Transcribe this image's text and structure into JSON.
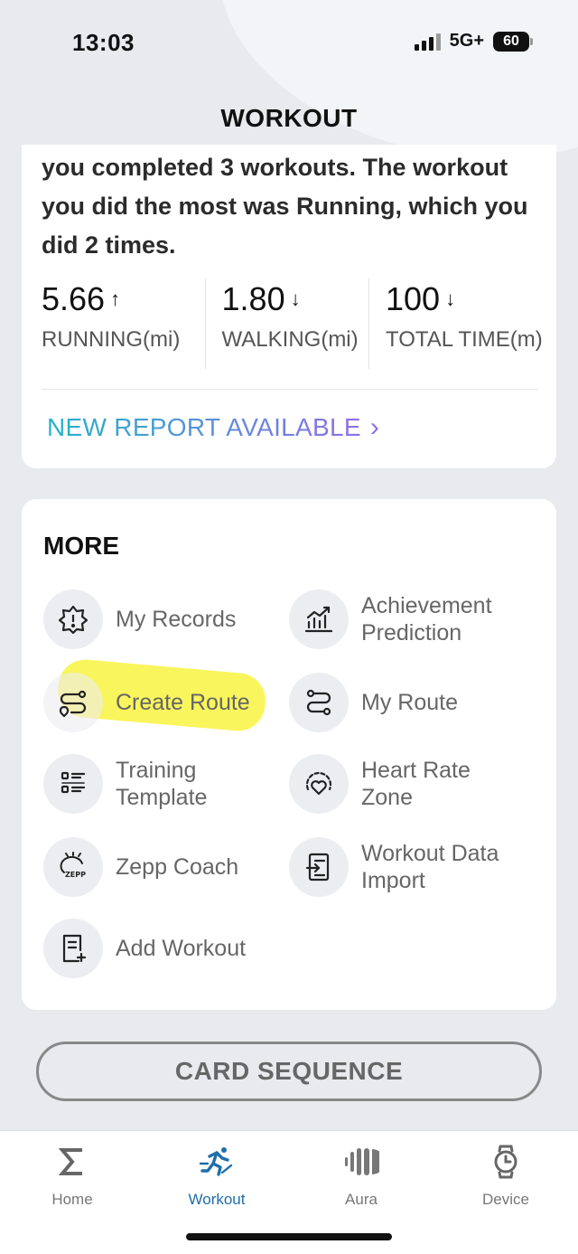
{
  "status_bar": {
    "time": "13:03",
    "network": "5G+",
    "battery": "60"
  },
  "header": {
    "title": "WORKOUT"
  },
  "report": {
    "text": "you completed 3 workouts. The workout you did the most was Running, which you did 2 times.",
    "stats": [
      {
        "value": "5.66",
        "trend": "↑",
        "label": "RUNNING(mi)"
      },
      {
        "value": "1.80",
        "trend": "↓",
        "label": "WALKING(mi)"
      },
      {
        "value": "100",
        "trend": "↓",
        "label": "TOTAL TIME(m)"
      }
    ],
    "new_report_label": "NEW REPORT AVAILABLE"
  },
  "more": {
    "title": "MORE",
    "items": [
      {
        "label": "My Records",
        "icon": "records-badge-icon"
      },
      {
        "label": "Achievement Prediction",
        "icon": "trend-chart-icon"
      },
      {
        "label": "Create Route",
        "icon": "create-route-icon"
      },
      {
        "label": "My Route",
        "icon": "route-icon"
      },
      {
        "label": "Training Template",
        "icon": "template-list-icon"
      },
      {
        "label": "Heart Rate Zone",
        "icon": "heart-rate-icon"
      },
      {
        "label": "Zepp Coach",
        "icon": "zepp-coach-icon",
        "icon_text": "ZEPP"
      },
      {
        "label": "Workout Data Import",
        "icon": "data-import-icon"
      },
      {
        "label": "Add Workout",
        "icon": "add-workout-icon"
      }
    ]
  },
  "card_sequence_label": "CARD SEQUENCE",
  "tabs": [
    {
      "label": "Home",
      "icon": "sigma-icon",
      "active": false
    },
    {
      "label": "Workout",
      "icon": "runner-icon",
      "active": true
    },
    {
      "label": "Aura",
      "icon": "aura-icon",
      "active": false
    },
    {
      "label": "Device",
      "icon": "watch-icon",
      "active": false
    }
  ],
  "colors": {
    "accent": "#1f6fa8",
    "gradient_start": "#25b3c8",
    "gradient_end": "#8f6ee8",
    "highlight": "#f7f126"
  }
}
